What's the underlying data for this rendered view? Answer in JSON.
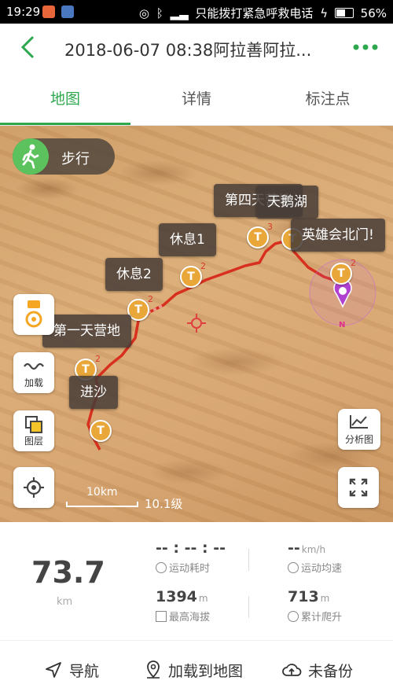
{
  "status_bar": {
    "time": "19:29",
    "notification": "只能拨打紧急呼救电话",
    "battery": "56%"
  },
  "header": {
    "title": "2018-06-07 08:38阿拉善阿拉..."
  },
  "tabs": [
    {
      "label": "地图",
      "active": true
    },
    {
      "label": "详情",
      "active": false
    },
    {
      "label": "标注点",
      "active": false
    }
  ],
  "map": {
    "mode_label": "步行",
    "side_buttons": {
      "load_label": "加载",
      "layer_label": "图层"
    },
    "analysis_label": "分析图",
    "scale_text": "10km",
    "zoom_text": "10.1级",
    "compass": "N",
    "markers": [
      {
        "label": "进沙"
      },
      {
        "label": "第一天营地",
        "count": "2"
      },
      {
        "label": "休息2",
        "count": "2"
      },
      {
        "label": "休息1",
        "count": "2"
      },
      {
        "label": "第四天营地",
        "count": "3"
      },
      {
        "label": "天鹅湖"
      },
      {
        "label": "英雄会北门!",
        "count": "2"
      }
    ],
    "colors": {
      "track": "#d8301f",
      "pin": "#e9a73a",
      "end": "#b040d0",
      "accent": "#2ea84e"
    }
  },
  "stats": {
    "distance": "73.7",
    "distance_unit": "km",
    "duration": "-- : -- : --",
    "duration_label": "运动耗时",
    "avg_speed": "--",
    "avg_speed_unit": "km/h",
    "avg_speed_label": "运动均速",
    "max_alt": "1394",
    "max_alt_unit": "m",
    "max_alt_label": "最高海拔",
    "climb": "713",
    "climb_unit": "m",
    "climb_label": "累计爬升"
  },
  "actions": {
    "navigate": "导航",
    "load_to_map": "加载到地图",
    "backup": "未备份"
  }
}
